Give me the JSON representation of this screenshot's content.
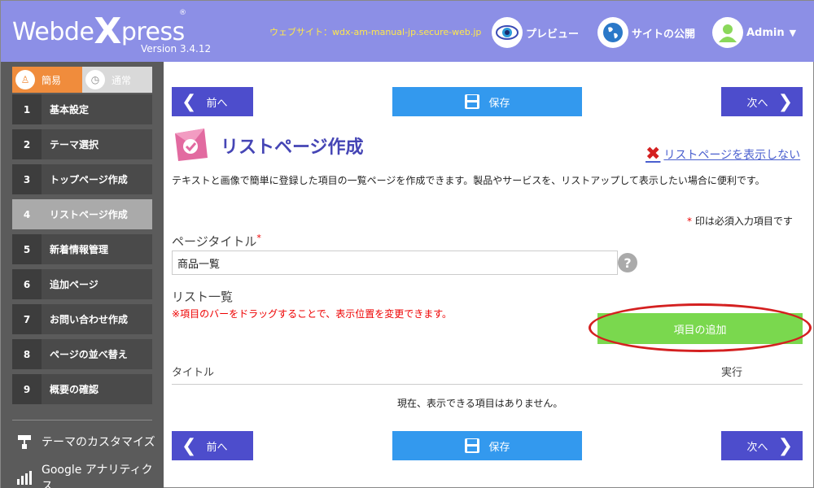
{
  "header": {
    "logo_pre": "Webde",
    "logo_x": "X",
    "logo_post": "press",
    "logo_reg": "®",
    "version": "Version 3.4.12",
    "website": "ウェブサイト：wdx-am-manual-jp.secure-web.jp",
    "preview_label": "プレビュー",
    "publish_label": "サイトの公開",
    "admin_label": "Admin"
  },
  "sidebar": {
    "mode_easy": "簡易",
    "mode_normal": "通常",
    "steps": [
      {
        "num": "1",
        "label": "基本設定"
      },
      {
        "num": "2",
        "label": "テーマ選択"
      },
      {
        "num": "3",
        "label": "トップページ作成"
      },
      {
        "num": "4",
        "label": "リストページ作成"
      },
      {
        "num": "5",
        "label": "新着情報管理"
      },
      {
        "num": "6",
        "label": "追加ページ"
      },
      {
        "num": "7",
        "label": "お問い合わせ作成"
      },
      {
        "num": "8",
        "label": "ページの並べ替え"
      },
      {
        "num": "9",
        "label": "概要の確認"
      }
    ],
    "customize_label": "テーマのカスタマイズ",
    "analytics_label": "Google アナリティクス"
  },
  "nav": {
    "prev": "前へ",
    "save": "保存",
    "next": "次へ"
  },
  "main": {
    "title": "リストページ作成",
    "hide_link": "リストページを表示しない",
    "description": "テキストと画像で簡単に登録した項目の一覧ページを作成できます。製品やサービスを、リストアップして表示したい場合に便利です。",
    "required_star": "*",
    "required_note": " 印は必須入力項目です",
    "page_title_label": "ページタイトル",
    "page_title_value": "商品一覧",
    "help": "?",
    "list_label": "リスト一覧",
    "drag_mark": "※",
    "drag_note": "項目のバーをドラッグすることで、表示位置を変更できます。",
    "add_button": "項目の追加",
    "col_title": "タイトル",
    "col_exec": "実行",
    "empty_message": "現在、表示できる項目はありません。"
  },
  "colors": {
    "header_bg": "#8c8fe6",
    "sidebar_bg": "#5b5b5b",
    "nav_blue": "#4d4dcc",
    "save_blue": "#3399ee",
    "add_green": "#7ad84e",
    "annotation_red": "#d42020"
  }
}
